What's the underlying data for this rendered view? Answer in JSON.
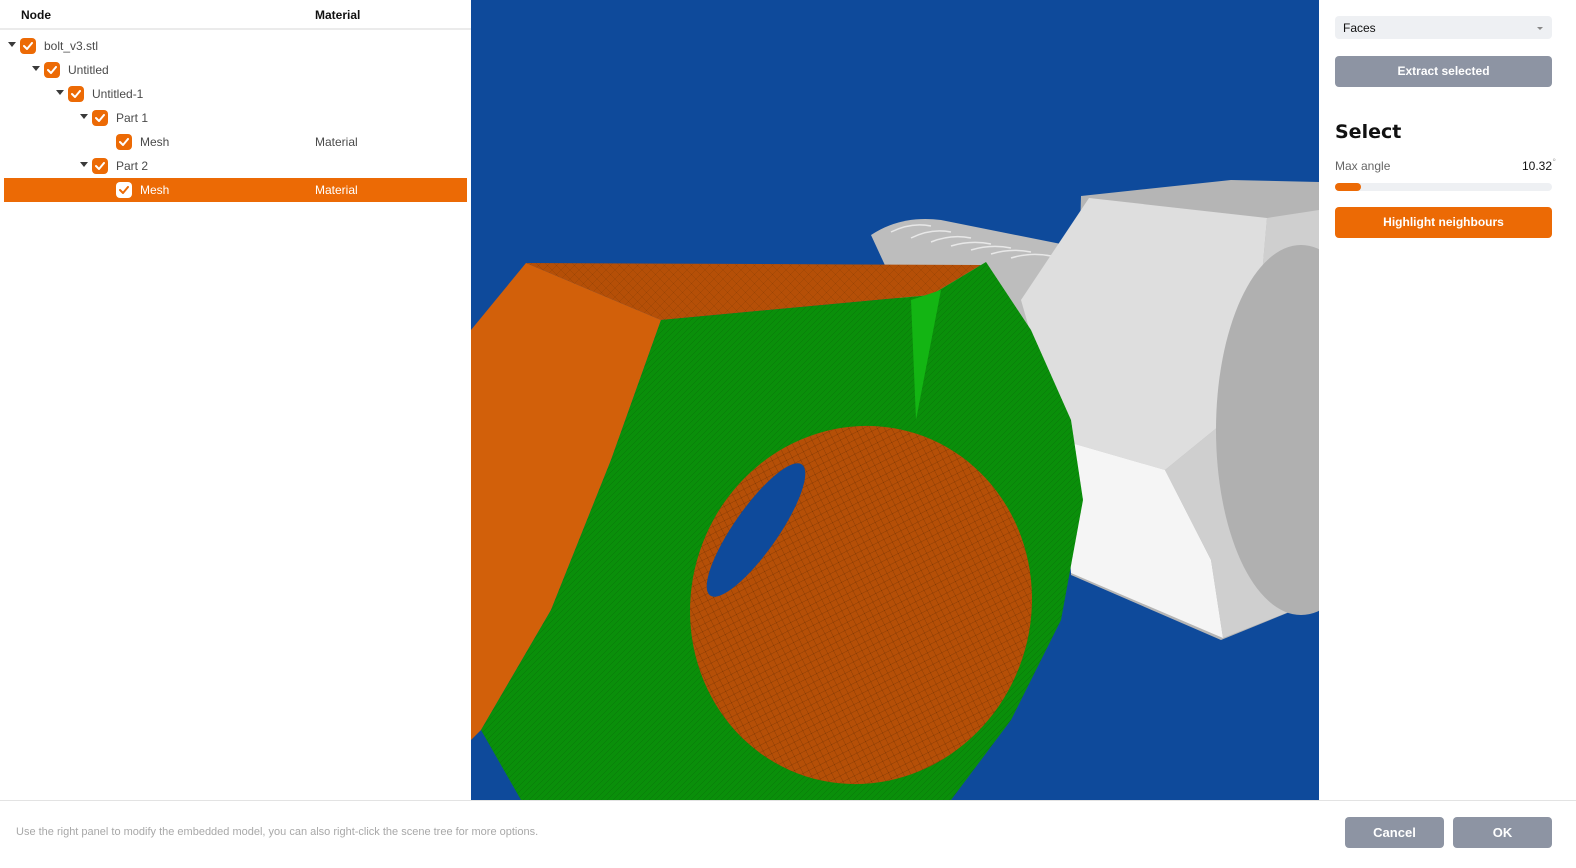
{
  "tree": {
    "headers": {
      "node": "Node",
      "material": "Material"
    },
    "rows": [
      {
        "label": "bolt_v3.stl",
        "material": "",
        "depth": 0,
        "expanded": true,
        "checked": true,
        "selected": false
      },
      {
        "label": "Untitled",
        "material": "",
        "depth": 1,
        "expanded": true,
        "checked": true,
        "selected": false
      },
      {
        "label": "Untitled-1",
        "material": "",
        "depth": 2,
        "expanded": true,
        "checked": true,
        "selected": false
      },
      {
        "label": "Part 1",
        "material": "",
        "depth": 3,
        "expanded": true,
        "checked": true,
        "selected": false
      },
      {
        "label": "Mesh",
        "material": "Material",
        "depth": 4,
        "expanded": null,
        "checked": true,
        "selected": false
      },
      {
        "label": "Part 2",
        "material": "",
        "depth": 3,
        "expanded": true,
        "checked": true,
        "selected": false
      },
      {
        "label": "Mesh",
        "material": "Material",
        "depth": 4,
        "expanded": null,
        "checked": true,
        "selected": true
      }
    ]
  },
  "viewport": {
    "background_color": "#0e4a9b",
    "selected_face_color": "#0a8f0a",
    "mesh_color": "#d2600a",
    "bolt_color": "#e0e0e0"
  },
  "panel": {
    "mode_dropdown": {
      "value": "Faces"
    },
    "extract_label": "Extract selected",
    "select_title": "Select",
    "max_angle": {
      "label": "Max angle",
      "value": "10.32",
      "unit": "°",
      "slider_fraction": 0.12
    },
    "highlight_label": "Highlight neighbours"
  },
  "footer": {
    "hint": "Use the right panel to modify the embedded model, you can also right-click the scene tree for more options.",
    "cancel_label": "Cancel",
    "ok_label": "OK"
  },
  "colors": {
    "accent": "#ec6a05",
    "button_grey": "#8d94a3"
  }
}
